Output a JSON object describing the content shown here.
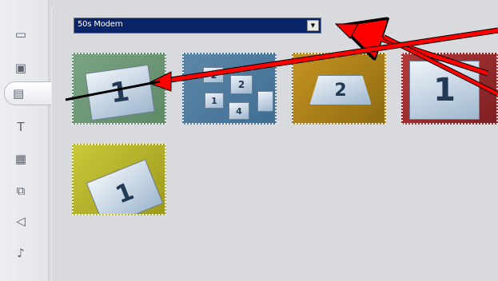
{
  "dropdown": {
    "selected": "50s Modern"
  },
  "sidebar": {
    "tools": [
      {
        "icon": "titles-icon"
      },
      {
        "icon": "transitions-icon"
      },
      {
        "icon": "themes-icon"
      },
      {
        "icon": "text-icon"
      },
      {
        "icon": "frames-icon"
      },
      {
        "icon": "effects-icon"
      },
      {
        "icon": "audio-icon"
      },
      {
        "icon": "music-icon"
      }
    ]
  },
  "thumbnails": [
    {
      "label": "1"
    },
    {
      "labels": [
        "1",
        "2",
        "4"
      ]
    },
    {
      "label": "2"
    },
    {
      "label": "1"
    },
    {
      "label": "1"
    }
  ],
  "colors": {
    "arrow": "#ff0000",
    "dropdown_bg": "#0a246a"
  }
}
